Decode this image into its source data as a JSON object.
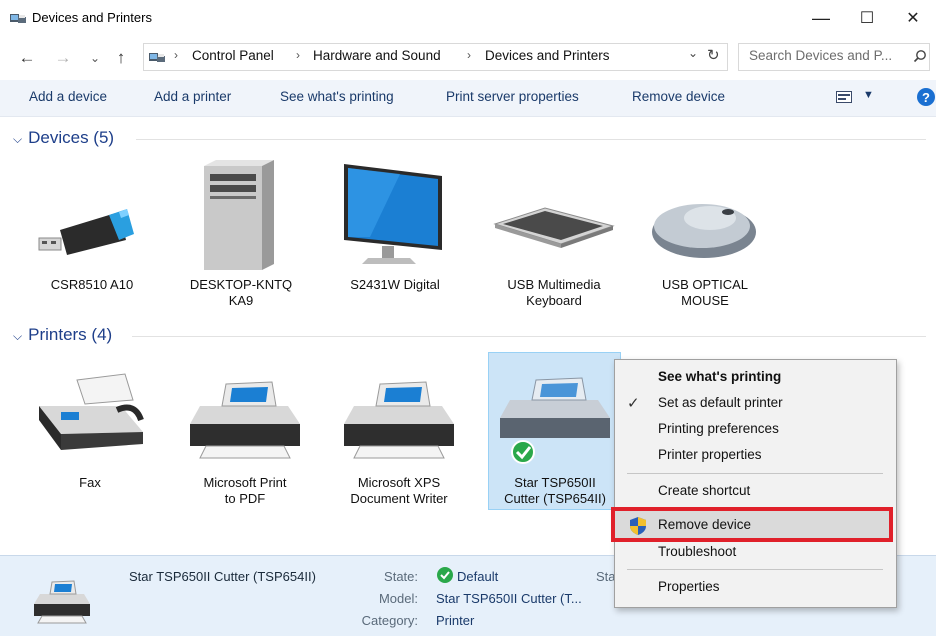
{
  "window": {
    "title": "Devices and Printers",
    "minimize": "—",
    "maximize": "☐",
    "close": "✕"
  },
  "nav": {
    "back": "←",
    "forward": "→",
    "recent": "⌄",
    "up": "↑",
    "breadcrumb": [
      "Control Panel",
      "Hardware and Sound",
      "Devices and Printers"
    ],
    "sep": "›",
    "address_drop": "⌄",
    "refresh": "↻",
    "search_placeholder": "Search Devices and P..."
  },
  "toolbar": {
    "add_device": "Add a device",
    "add_printer": "Add a printer",
    "see_printing": "See what's printing",
    "print_server": "Print server properties",
    "remove_device": "Remove device",
    "view_drop": "▼",
    "help": "?"
  },
  "groups": {
    "devices_header": "Devices (5)",
    "printers_header": "Printers (4)",
    "chevron": "⌵"
  },
  "devices": [
    {
      "label1": "CSR8510 A10",
      "label2": "",
      "icon": "usb-dongle-icon"
    },
    {
      "label1": "DESKTOP-KNTQ",
      "label2": "KA9",
      "icon": "desktop-tower-icon"
    },
    {
      "label1": "S2431W Digital",
      "label2": "",
      "icon": "monitor-icon"
    },
    {
      "label1": "USB Multimedia",
      "label2": "Keyboard",
      "icon": "keyboard-icon"
    },
    {
      "label1": "USB OPTICAL",
      "label2": "MOUSE",
      "icon": "mouse-icon"
    }
  ],
  "printers": [
    {
      "label1": "Fax",
      "label2": "",
      "icon": "fax-icon"
    },
    {
      "label1": "Microsoft Print",
      "label2": "to PDF",
      "icon": "printer-icon"
    },
    {
      "label1": "Microsoft XPS",
      "label2": "Document Writer",
      "icon": "printer-icon"
    },
    {
      "label1": "Star TSP650II",
      "label2": "Cutter (TSP654II)",
      "icon": "printer-icon"
    }
  ],
  "context_menu": {
    "see_printing": "See what's printing",
    "set_default": "Set as default printer",
    "check": "✓",
    "printing_prefs": "Printing preferences",
    "printer_props": "Printer properties",
    "create_shortcut": "Create shortcut",
    "remove_device": "Remove device",
    "troubleshoot": "Troubleshoot",
    "properties": "Properties"
  },
  "status": {
    "name": "Star TSP650II Cutter (TSP654II)",
    "state_label": "State:",
    "state_value": "Default",
    "model_label": "Model:",
    "model_value": "Star TSP650II Cutter (T...",
    "category_label": "Category:",
    "category_value": "Printer",
    "cut_label": "Sta"
  },
  "colors": {
    "accent": "#1e3f8a",
    "selection": "#cce4f7",
    "highlight_box": "#e0202a",
    "default_check": "#2aa84a"
  }
}
